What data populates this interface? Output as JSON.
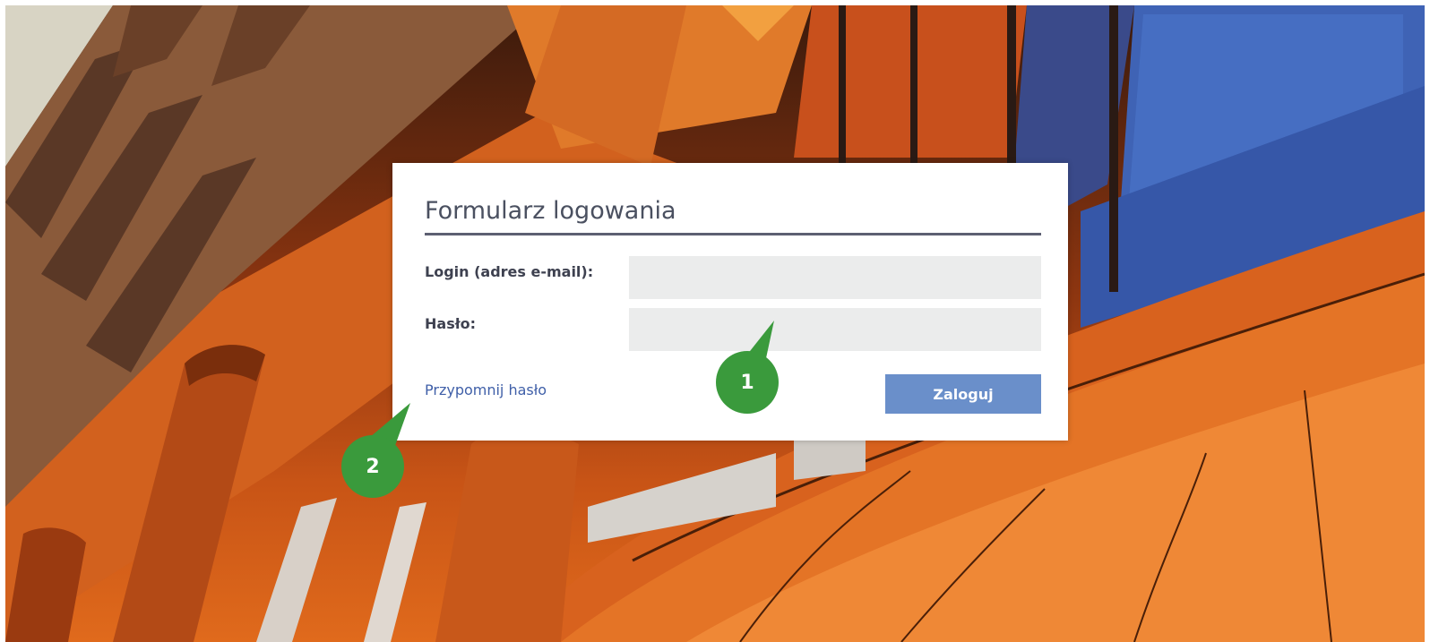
{
  "login_form": {
    "title": "Formularz logowania",
    "login_label": "Login (adres e-mail):",
    "login_value": "",
    "password_label": "Hasło:",
    "password_value": "",
    "remind_password_link": "Przypomnij hasło",
    "login_button": "Zaloguj"
  },
  "callouts": [
    {
      "number": "1"
    },
    {
      "number": "2"
    }
  ],
  "colors": {
    "title_rule": "#5d6072",
    "input_background": "#ebecec",
    "link": "#3f5fa8",
    "button": "#6a8fca",
    "callout": "#3a9a3c"
  }
}
